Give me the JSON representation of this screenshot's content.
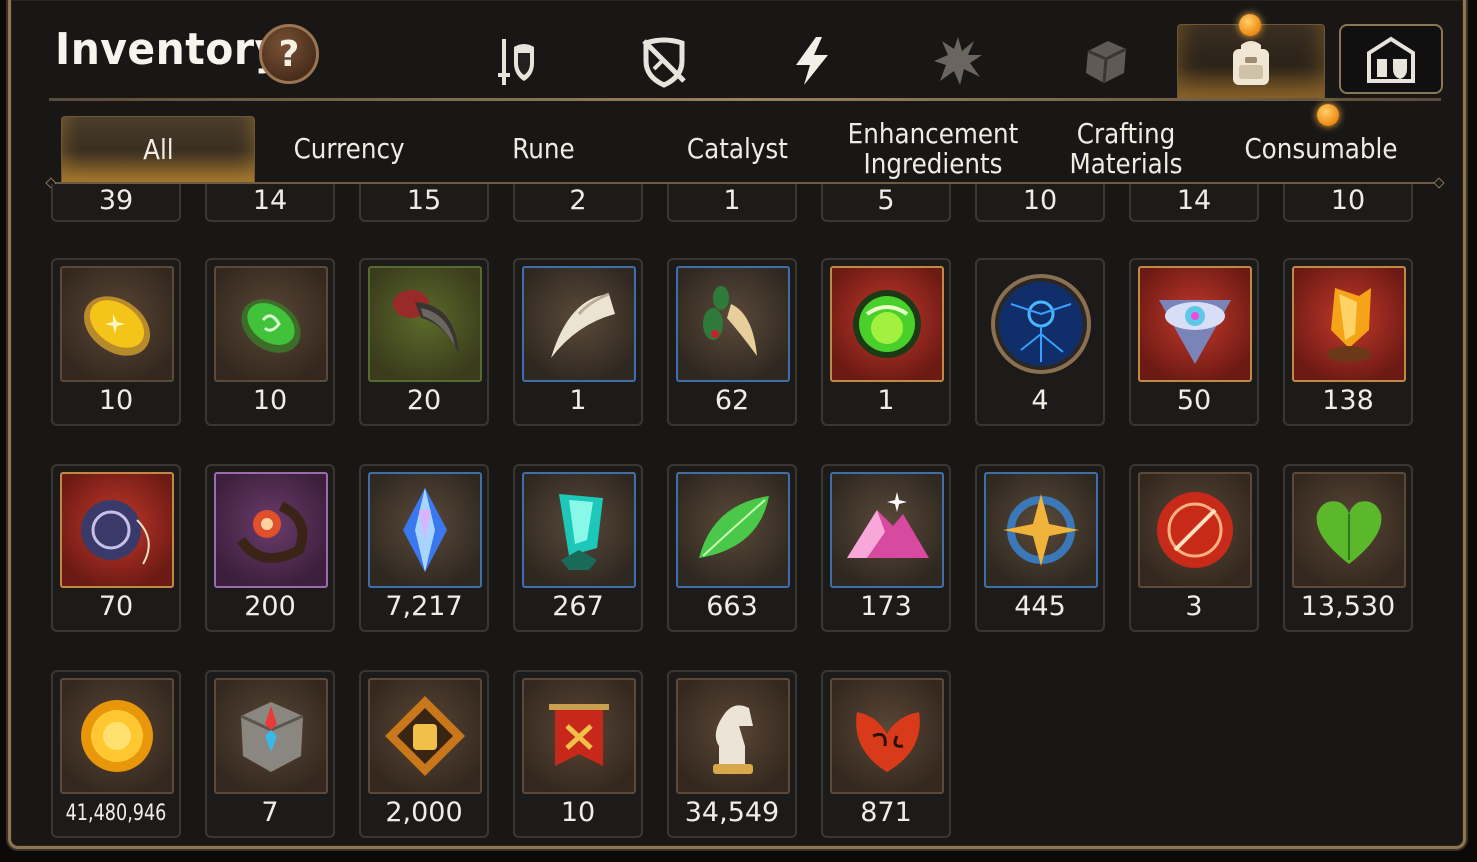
{
  "header": {
    "title": "Inventory",
    "help_label": "?"
  },
  "category_tabs": [
    {
      "name": "gear-icon-tab",
      "icon": "sword-shield-icon"
    },
    {
      "name": "crossed-shield-tab",
      "icon": "crossed-shield-icon"
    },
    {
      "name": "lightning-tab",
      "icon": "lightning-icon"
    },
    {
      "name": "splat-tab",
      "icon": "splat-icon"
    },
    {
      "name": "cube-tab",
      "icon": "cube-icon"
    },
    {
      "name": "backpack-tab",
      "icon": "backpack-icon",
      "active": true
    },
    {
      "name": "fortress-tab",
      "icon": "fortress-icon"
    }
  ],
  "sub_tabs": [
    {
      "label": "All",
      "active": true
    },
    {
      "label": "Currency"
    },
    {
      "label": "Rune"
    },
    {
      "label": "Catalyst"
    },
    {
      "label": "Enhancement Ingredients"
    },
    {
      "label": "Crafting Materials"
    },
    {
      "label": "Consumable"
    }
  ],
  "partial_row": [
    "39",
    "14",
    "15",
    "2",
    "1",
    "5",
    "10",
    "14",
    "10"
  ],
  "items": [
    {
      "icon": "yellow-gem-icon",
      "count": "10",
      "rarity": "brown"
    },
    {
      "icon": "green-gem-icon",
      "count": "10",
      "rarity": "brown"
    },
    {
      "icon": "claw-icon",
      "count": "20",
      "rarity": "green"
    },
    {
      "icon": "fang-icon",
      "count": "1",
      "rarity": "blue"
    },
    {
      "icon": "ginseng-root-icon",
      "count": "62",
      "rarity": "blue"
    },
    {
      "icon": "green-orb-icon",
      "count": "1",
      "rarity": "red"
    },
    {
      "icon": "blue-rune-disc-icon",
      "count": "4",
      "rarity": "none"
    },
    {
      "icon": "eye-crest-icon",
      "count": "50",
      "rarity": "red"
    },
    {
      "icon": "amber-crystal-icon",
      "count": "138",
      "rarity": "red"
    },
    {
      "icon": "pendant-icon",
      "count": "70",
      "rarity": "red"
    },
    {
      "icon": "flower-ring-icon",
      "count": "200",
      "rarity": "purple"
    },
    {
      "icon": "blue-crystal-icon",
      "count": "7,217",
      "rarity": "blue"
    },
    {
      "icon": "teal-crystal-icon",
      "count": "267",
      "rarity": "blue"
    },
    {
      "icon": "leaf-icon",
      "count": "663",
      "rarity": "blue"
    },
    {
      "icon": "pink-mountain-icon",
      "count": "173",
      "rarity": "blue"
    },
    {
      "icon": "star-pendant-icon",
      "count": "445",
      "rarity": "blue"
    },
    {
      "icon": "red-seal-icon",
      "count": "3",
      "rarity": "brown"
    },
    {
      "icon": "green-heart-icon",
      "count": "13,530",
      "rarity": "brown"
    },
    {
      "icon": "gold-coin-icon",
      "count": "41,480,946",
      "rarity": "brown",
      "small": true
    },
    {
      "icon": "compass-stone-icon",
      "count": "7",
      "rarity": "brown"
    },
    {
      "icon": "fist-emblem-icon",
      "count": "2,000",
      "rarity": "brown"
    },
    {
      "icon": "war-banner-icon",
      "count": "10",
      "rarity": "brown"
    },
    {
      "icon": "chess-knight-icon",
      "count": "34,549",
      "rarity": "brown"
    },
    {
      "icon": "red-leaf-icon",
      "count": "871",
      "rarity": "brown"
    }
  ],
  "colors": {
    "accent": "#f0a030",
    "panel_border": "#8c7654",
    "text": "#f3ede0"
  }
}
